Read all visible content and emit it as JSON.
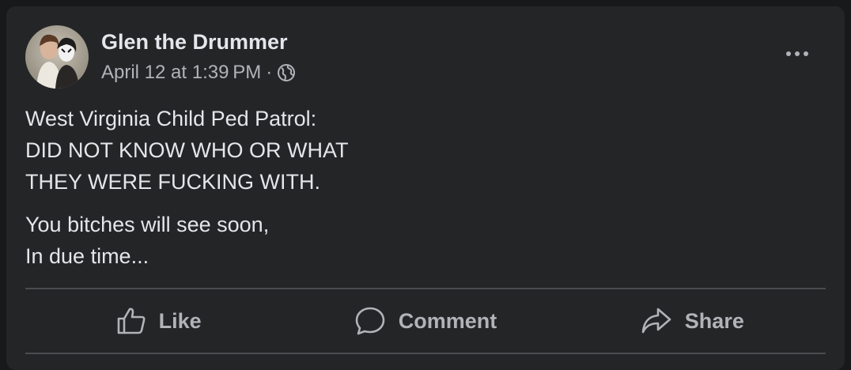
{
  "post": {
    "author": "Glen the Drummer",
    "timestamp": "April 12 at 1:39 PM",
    "separator": "·",
    "audience_icon": "globe-icon",
    "menu_icon": "more-options-icon",
    "paragraphs": [
      {
        "lines": [
          "West Virginia Child Ped Patrol:",
          "DID NOT KNOW WHO OR WHAT",
          "THEY WERE FUCKING WITH."
        ]
      },
      {
        "lines": [
          "You bitches will see soon,",
          "In due time..."
        ]
      }
    ]
  },
  "actions": {
    "like": {
      "label": "Like",
      "icon": "thumbs-up-icon"
    },
    "comment": {
      "label": "Comment",
      "icon": "comment-icon"
    },
    "share": {
      "label": "Share",
      "icon": "share-icon"
    }
  },
  "colors": {
    "card_background": "#242526",
    "primary_text": "#e4e6eb",
    "secondary_text": "#b0b3b8",
    "divider": "#4a4c4f"
  }
}
